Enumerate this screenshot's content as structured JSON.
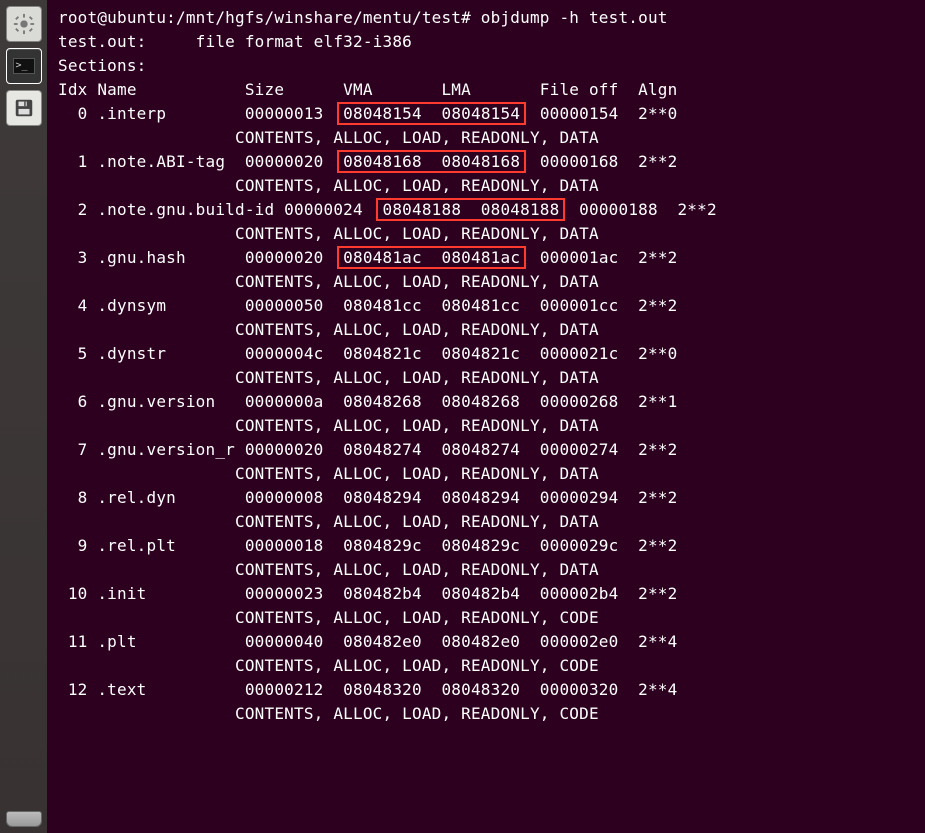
{
  "prompt_prefix": "root@ubuntu:/mnt/hgfs/winshare/mentu/test# ",
  "command": "objdump -h test.out",
  "file_line_a": "test.out:     file format ",
  "file_line_b": "elf32-i386",
  "sections_label": "Sections:",
  "headers": {
    "idx": "Idx",
    "name": "Name",
    "size": "Size",
    "vma": "VMA",
    "lma": "LMA",
    "fileoff": "File off",
    "algn": "Algn"
  },
  "rows": [
    {
      "idx": "0",
      "name": ".interp",
      "size": "00000013",
      "vma": "08048154",
      "lma": "08048154",
      "off": "00000154",
      "algn": "2**0",
      "attrs": "CONTENTS, ALLOC, LOAD, READONLY, DATA",
      "box": true
    },
    {
      "idx": "1",
      "name": ".note.ABI-tag",
      "size": "00000020",
      "vma": "08048168",
      "lma": "08048168",
      "off": "00000168",
      "algn": "2**2",
      "attrs": "CONTENTS, ALLOC, LOAD, READONLY, DATA",
      "box": true
    },
    {
      "idx": "2",
      "name": ".note.gnu.build-id",
      "size": "00000024",
      "vma": "08048188",
      "lma": "08048188",
      "off": "00000188",
      "algn": "2**2",
      "attrs": "CONTENTS, ALLOC, LOAD, READONLY, DATA",
      "box": true,
      "sizeInName": true
    },
    {
      "idx": "3",
      "name": ".gnu.hash",
      "size": "00000020",
      "vma": "080481ac",
      "lma": "080481ac",
      "off": "000001ac",
      "algn": "2**2",
      "attrs": "CONTENTS, ALLOC, LOAD, READONLY, DATA",
      "box": true
    },
    {
      "idx": "4",
      "name": ".dynsym",
      "size": "00000050",
      "vma": "080481cc",
      "lma": "080481cc",
      "off": "000001cc",
      "algn": "2**2",
      "attrs": "CONTENTS, ALLOC, LOAD, READONLY, DATA",
      "box": false
    },
    {
      "idx": "5",
      "name": ".dynstr",
      "size": "0000004c",
      "vma": "0804821c",
      "lma": "0804821c",
      "off": "0000021c",
      "algn": "2**0",
      "attrs": "CONTENTS, ALLOC, LOAD, READONLY, DATA",
      "box": false
    },
    {
      "idx": "6",
      "name": ".gnu.version",
      "size": "0000000a",
      "vma": "08048268",
      "lma": "08048268",
      "off": "00000268",
      "algn": "2**1",
      "attrs": "CONTENTS, ALLOC, LOAD, READONLY, DATA",
      "box": false
    },
    {
      "idx": "7",
      "name": ".gnu.version_r",
      "size": "00000020",
      "vma": "08048274",
      "lma": "08048274",
      "off": "00000274",
      "algn": "2**2",
      "attrs": "CONTENTS, ALLOC, LOAD, READONLY, DATA",
      "box": false,
      "sizeInName": true
    },
    {
      "idx": "8",
      "name": ".rel.dyn",
      "size": "00000008",
      "vma": "08048294",
      "lma": "08048294",
      "off": "00000294",
      "algn": "2**2",
      "attrs": "CONTENTS, ALLOC, LOAD, READONLY, DATA",
      "box": false
    },
    {
      "idx": "9",
      "name": ".rel.plt",
      "size": "00000018",
      "vma": "0804829c",
      "lma": "0804829c",
      "off": "0000029c",
      "algn": "2**2",
      "attrs": "CONTENTS, ALLOC, LOAD, READONLY, DATA",
      "box": false
    },
    {
      "idx": "10",
      "name": ".init",
      "size": "00000023",
      "vma": "080482b4",
      "lma": "080482b4",
      "off": "000002b4",
      "algn": "2**2",
      "attrs": "CONTENTS, ALLOC, LOAD, READONLY, CODE",
      "box": false
    },
    {
      "idx": "11",
      "name": ".plt",
      "size": "00000040",
      "vma": "080482e0",
      "lma": "080482e0",
      "off": "000002e0",
      "algn": "2**4",
      "attrs": "CONTENTS, ALLOC, LOAD, READONLY, CODE",
      "box": false
    },
    {
      "idx": "12",
      "name": ".text",
      "size": "00000212",
      "vma": "08048320",
      "lma": "08048320",
      "off": "00000320",
      "algn": "2**4",
      "attrs": "CONTENTS, ALLOC, LOAD, READONLY, CODE",
      "box": false
    }
  ]
}
